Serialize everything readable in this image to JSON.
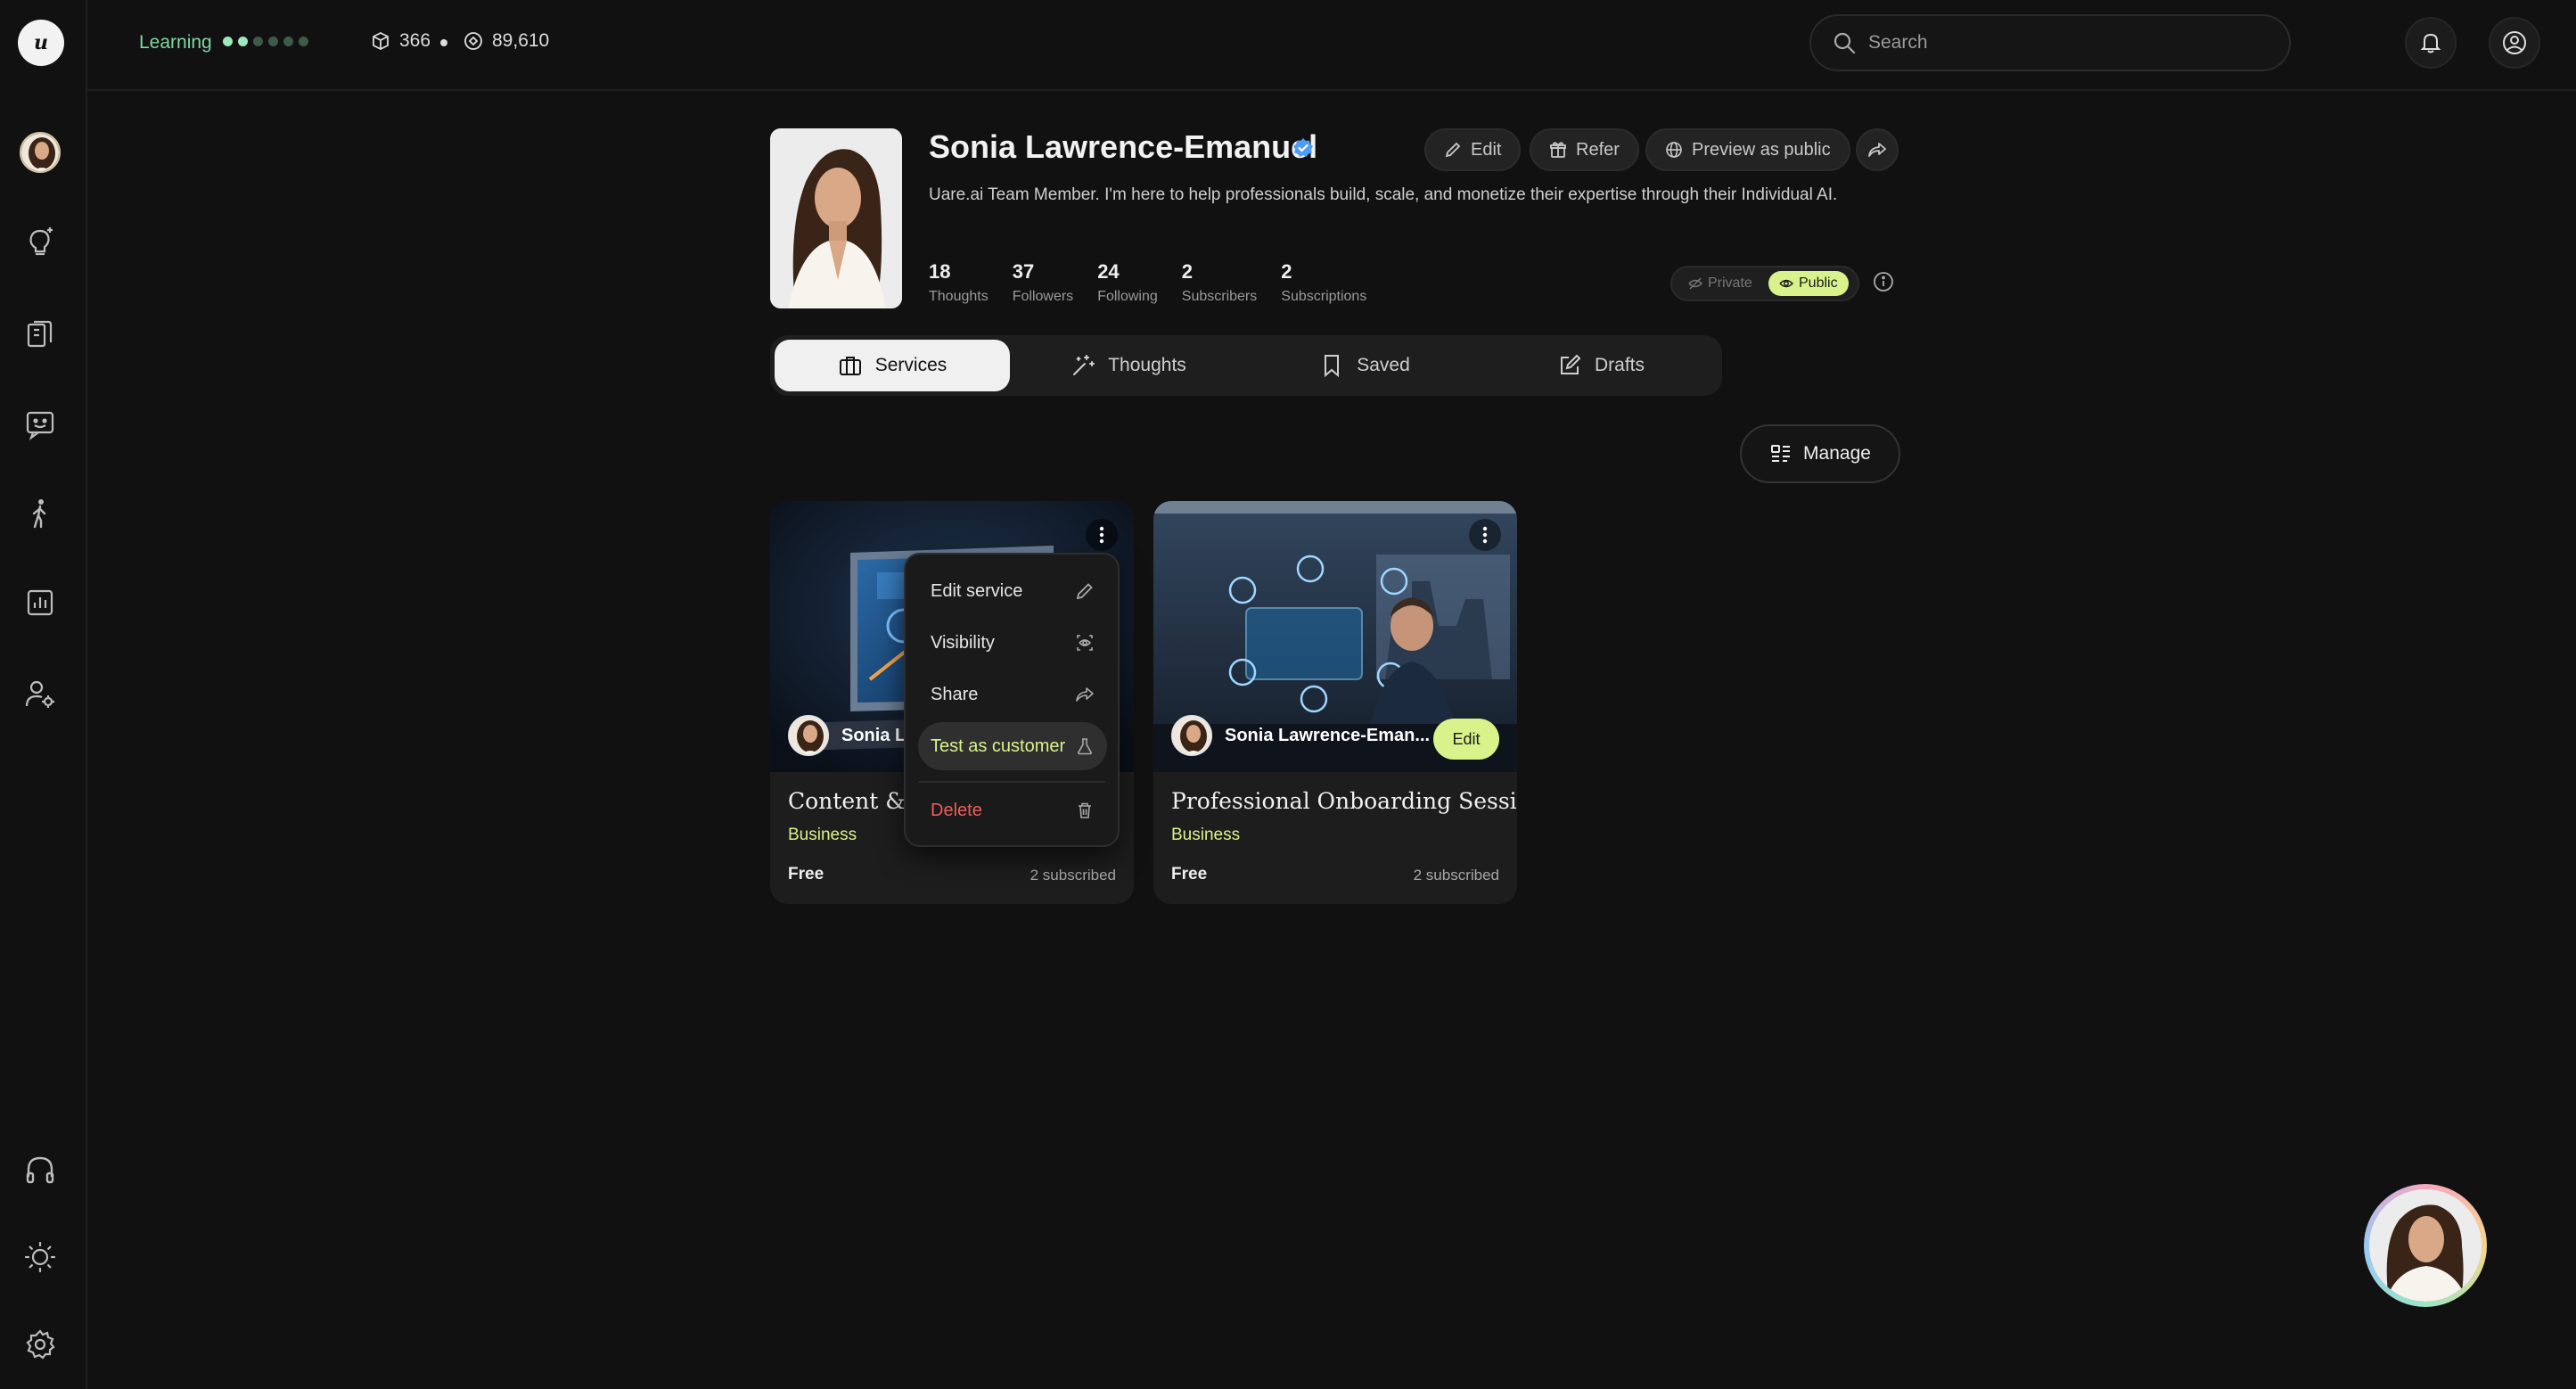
{
  "topbar": {
    "level_label": "Learning",
    "level_dots_total": 6,
    "level_dots_filled": 2,
    "stat_a": "366",
    "stat_b": "89,610",
    "search_placeholder": "Search",
    "icons": [
      "box-icon",
      "badge-icon",
      "search-icon",
      "bell-icon",
      "user-circle-icon"
    ]
  },
  "rail": {
    "icons": [
      "brain-spark-icon",
      "library-icon",
      "chat-smile-icon",
      "walking-person-icon",
      "bar-chart-icon",
      "user-settings-icon",
      "headphones-icon",
      "sun-icon",
      "gear-icon"
    ]
  },
  "profile": {
    "name": "Sonia Lawrence-Emanuel",
    "bio": "Uare.ai Team Member. I'm here to help professionals build, scale, and monetize their expertise through their Individual AI.",
    "actions": {
      "edit": "Edit",
      "refer": "Refer",
      "preview": "Preview as public"
    },
    "stats": [
      {
        "value": "18",
        "label": "Thoughts"
      },
      {
        "value": "37",
        "label": "Followers"
      },
      {
        "value": "24",
        "label": "Following"
      },
      {
        "value": "2",
        "label": "Subscribers"
      },
      {
        "value": "2",
        "label": "Subscriptions"
      }
    ],
    "visibility": {
      "private_label": "Private",
      "public_label": "Public",
      "selected": "Public"
    }
  },
  "tabs": [
    {
      "label": "Services",
      "active": true
    },
    {
      "label": "Thoughts",
      "active": false
    },
    {
      "label": "Saved",
      "active": false
    },
    {
      "label": "Drafts",
      "active": false
    }
  ],
  "manage_label": "Manage",
  "cards": [
    {
      "author": "Sonia La",
      "title": "Content & M",
      "category": "Business",
      "price": "Free",
      "subscribed": "2 subscribed"
    },
    {
      "author": "Sonia Lawrence-Eman...",
      "title": "Professional Onboarding Session",
      "category": "Business",
      "price": "Free",
      "subscribed": "2 subscribed",
      "edit_label": "Edit"
    }
  ],
  "context_menu": {
    "items": [
      {
        "label": "Edit service",
        "icon": "pencil-icon"
      },
      {
        "label": "Visibility",
        "icon": "visibility-icon"
      },
      {
        "label": "Share",
        "icon": "share-icon"
      },
      {
        "label": "Test as customer",
        "icon": "flask-icon",
        "highlighted": true
      },
      {
        "label": "Delete",
        "icon": "trash-icon",
        "danger": true
      }
    ]
  },
  "colors": {
    "accent_lime": "#d9f28c",
    "accent_green": "#7fd6a4",
    "danger": "#ef5d5d",
    "background": "#111111"
  }
}
